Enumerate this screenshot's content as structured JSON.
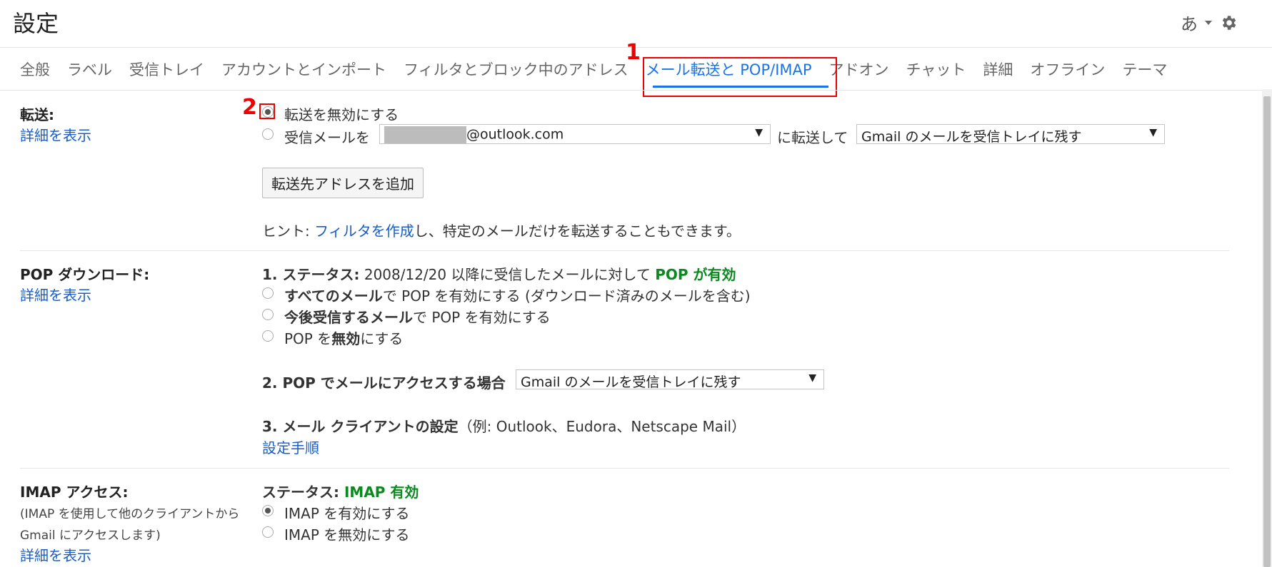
{
  "header": {
    "title": "設定",
    "lang_indicator": "あ",
    "icons": [
      "chevron-down-icon",
      "gear-icon"
    ]
  },
  "tabs": [
    {
      "label": "全般"
    },
    {
      "label": "ラベル"
    },
    {
      "label": "受信トレイ"
    },
    {
      "label": "アカウントとインポート"
    },
    {
      "label": "フィルタとブロック中のアドレス"
    },
    {
      "label": "メール転送と POP/IMAP",
      "active": true
    },
    {
      "label": "アドオン"
    },
    {
      "label": "チャット"
    },
    {
      "label": "詳細"
    },
    {
      "label": "オフライン"
    },
    {
      "label": "テーマ"
    }
  ],
  "annotations": {
    "step1": "1",
    "step2": "2",
    "color": "#e00000"
  },
  "forwarding": {
    "label": "転送:",
    "detail_link": "詳細を表示",
    "option_disable": "転送を無効にする",
    "option_forward_prefix": "受信メールを",
    "forward_address": "@outlook.com",
    "forward_to": "に転送して",
    "keep_option": "Gmail のメールを受信トレイに残す",
    "add_button": "転送先アドレスを追加",
    "hint_prefix": "ヒント: ",
    "hint_link": "フィルタを作成",
    "hint_suffix": "し、特定のメールだけを転送することもできます。"
  },
  "pop": {
    "label": "POP ダウンロード:",
    "detail_link": "詳細を表示",
    "status_prefix": "1. ステータス:",
    "status_text": " 2008/12/20 以降に受信したメールに対して ",
    "status_value": "POP が有効",
    "opt1_bold": "すべてのメール",
    "opt1_rest": "で POP を有効にする (ダウンロード済みのメールを含む)",
    "opt2_bold": "今後受信するメール",
    "opt2_rest": "で POP を有効にする",
    "opt3_pre": "POP を",
    "opt3_bold": "無効",
    "opt3_post": "にする",
    "access_label": "2. POP でメールにアクセスする場合",
    "access_value": "Gmail のメールを受信トレイに残す",
    "client_label": "3. メール クライアントの設定",
    "client_examples": "（例: Outlook、Eudora、Netscape Mail）",
    "setup_link": "設定手順"
  },
  "imap": {
    "label": "IMAP アクセス:",
    "desc1": "(IMAP を使用して他のクライアントから",
    "desc2": "Gmail にアクセスします)",
    "detail_link": "詳細を表示",
    "status_prefix": "ステータス: ",
    "status_value": "IMAP 有効",
    "opt_enable": "IMAP を有効にする",
    "opt_disable": "IMAP を無効にする"
  }
}
